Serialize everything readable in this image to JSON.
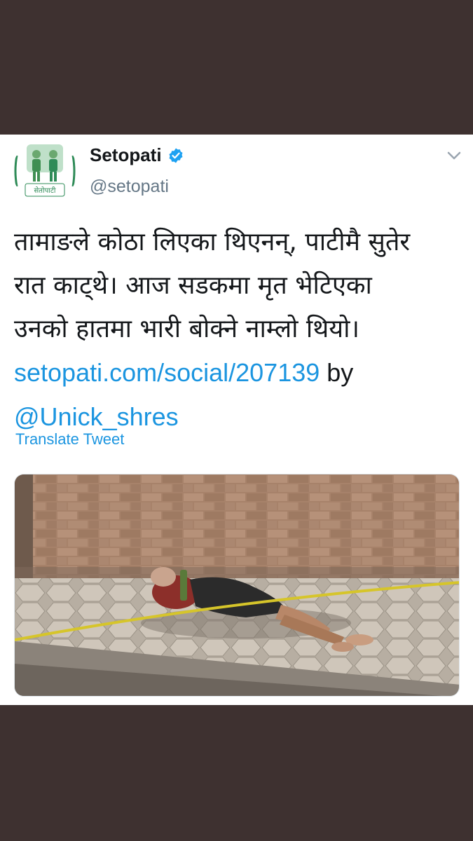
{
  "colors": {
    "background": "#3e3130",
    "card": "#ffffff",
    "link": "#1b95e0",
    "text": "#14171a",
    "secondary_text": "#657786",
    "verified": "#1da1f2",
    "brand_green": "#2e8b57"
  },
  "account": {
    "display_name": "Setopati",
    "handle": "@setopati",
    "avatar_logo_text": "सेतोपाटी",
    "verified": true,
    "icons": {
      "verified": "verified-badge-icon",
      "menu": "chevron-down-icon"
    }
  },
  "tweet": {
    "lines": [
      "तामाङले कोठा लिएका थिएनन्, पाटीमै सुतेर",
      "रात काट्थे। आज सडकमा मृत भेटिएका",
      "उनको हातमा भारी बोक्ने नाम्लो थियो।"
    ],
    "link": "setopati.com/social/207139",
    "by_text": " by",
    "mention": "@Unick_shres",
    "translate_label": "Translate Tweet"
  },
  "media": {
    "type": "photo"
  }
}
